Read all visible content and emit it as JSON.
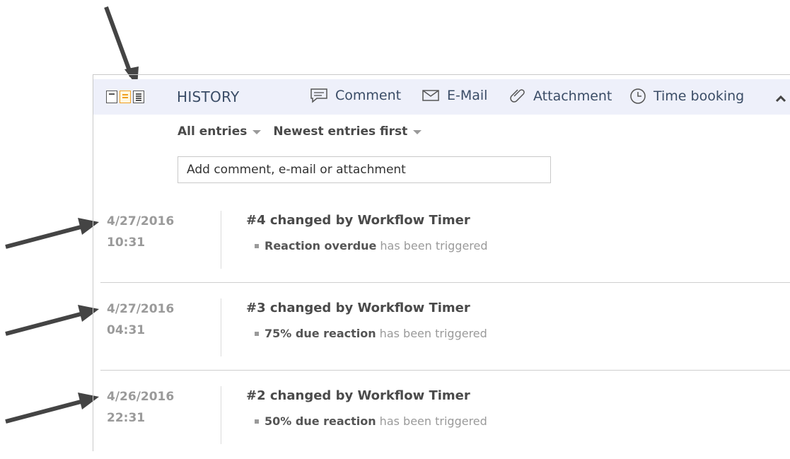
{
  "header": {
    "title": "HISTORY",
    "buttons": {
      "comment": "Comment",
      "email": "E-Mail",
      "attachment": "Attachment",
      "time_booking": "Time booking"
    },
    "icons": {
      "comment": "speech-bubble-icon",
      "email": "envelope-icon",
      "attachment": "paperclip-icon",
      "time_booking": "clock-icon",
      "collapse": "chevron-up-icon"
    },
    "active_view": "medium"
  },
  "filters": {
    "entries": "All entries",
    "order": "Newest entries first"
  },
  "comment_input": {
    "placeholder": "Add comment, e-mail or attachment"
  },
  "entries": [
    {
      "date": "4/27/2016",
      "time": "10:31",
      "title": "#4 changed by Workflow Timer",
      "event": "Reaction overdue",
      "suffix": "has been triggered"
    },
    {
      "date": "4/27/2016",
      "time": "04:31",
      "title": "#3 changed by Workflow Timer",
      "event": "75% due reaction",
      "suffix": "has been triggered"
    },
    {
      "date": "4/26/2016",
      "time": "22:31",
      "title": "#2 changed by Workflow Timer",
      "event": "50% due reaction",
      "suffix": "has been triggered"
    }
  ],
  "colors": {
    "header_bg": "#eef0fa",
    "active_view_icon": "#f0a020",
    "arrow": "#444444"
  }
}
